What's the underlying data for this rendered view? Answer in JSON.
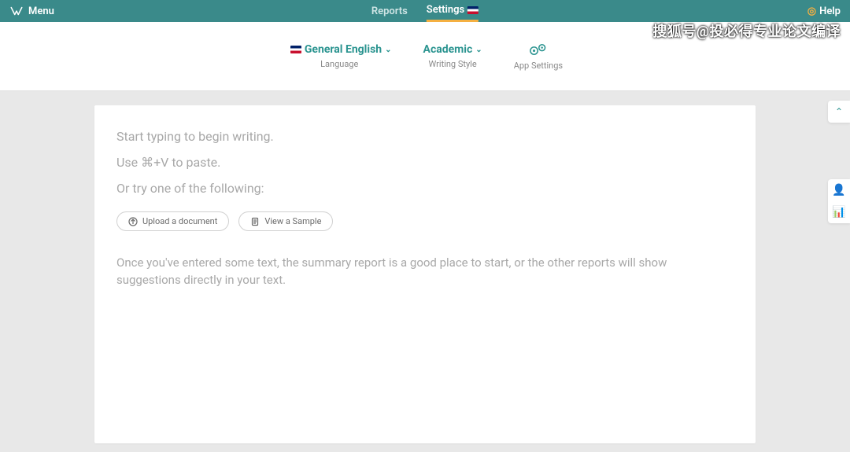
{
  "topbar": {
    "menu_label": "Menu",
    "tabs": [
      {
        "label": "Reports",
        "active": false
      },
      {
        "label": "Settings",
        "active": true
      }
    ],
    "help_label": "Help"
  },
  "subnav": {
    "items": [
      {
        "title": "General English",
        "sub": "Language",
        "has_flag": true
      },
      {
        "title": "Academic",
        "sub": "Writing Style",
        "has_flag": false
      },
      {
        "title": "",
        "sub": "App Settings",
        "is_gear": true
      }
    ]
  },
  "editor": {
    "lines": [
      "Start typing to begin writing.",
      "Use ⌘+V to paste.",
      "Or try one of the following:"
    ],
    "actions": [
      {
        "label": "Upload a document",
        "icon": "upload"
      },
      {
        "label": "View a Sample",
        "icon": "doc"
      }
    ],
    "hint": "Once you've entered some text, the summary report is a good place to start, or the other reports will show suggestions directly in your text."
  },
  "watermark": "搜狐号@投必得专业论文编译"
}
